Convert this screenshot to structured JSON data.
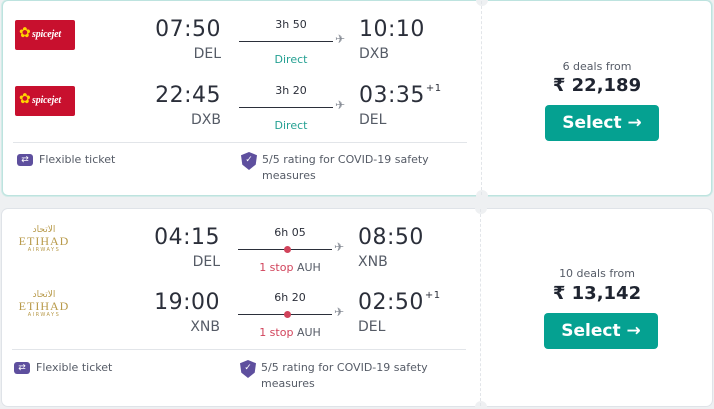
{
  "results": [
    {
      "legs": [
        {
          "airline_logo": "spicejet",
          "logo_text": "spicejet",
          "dep_time": "07:50",
          "dep_code": "DEL",
          "duration": "3h 50",
          "stops_label": "Direct",
          "stop_airport": "",
          "arr_time": "10:10",
          "arr_plus": "",
          "arr_code": "DXB"
        },
        {
          "airline_logo": "spicejet",
          "logo_text": "spicejet",
          "dep_time": "22:45",
          "dep_code": "DXB",
          "duration": "3h 20",
          "stops_label": "Direct",
          "stop_airport": "",
          "arr_time": "03:35",
          "arr_plus": "+1",
          "arr_code": "DEL"
        }
      ],
      "features": {
        "flexible": "Flexible ticket",
        "covid": "5/5 rating for COVID-19 safety measures"
      },
      "deals_label": "6 deals from",
      "price": "₹ 22,189",
      "select_label": "Select →"
    },
    {
      "legs": [
        {
          "airline_logo": "etihad",
          "logo_arabic": "الاتحاد",
          "logo_text": "ETIHAD",
          "logo_sub": "AIRWAYS",
          "dep_time": "04:15",
          "dep_code": "DEL",
          "duration": "6h 05",
          "stops_label": "1 stop",
          "stop_airport": "AUH",
          "arr_time": "08:50",
          "arr_plus": "",
          "arr_code": "XNB"
        },
        {
          "airline_logo": "etihad",
          "logo_arabic": "الاتحاد",
          "logo_text": "ETIHAD",
          "logo_sub": "AIRWAYS",
          "dep_time": "19:00",
          "dep_code": "XNB",
          "duration": "6h 20",
          "stops_label": "1 stop",
          "stop_airport": "AUH",
          "arr_time": "02:50",
          "arr_plus": "+1",
          "arr_code": "DEL"
        }
      ],
      "features": {
        "flexible": "Flexible ticket",
        "covid": "5/5 rating for COVID-19 safety measures"
      },
      "deals_label": "10 deals from",
      "price": "₹ 13,142",
      "select_label": "Select →"
    }
  ],
  "icons": {
    "plane": "plane-icon",
    "ticket": "flexible-ticket-icon",
    "shield": "shield-icon"
  },
  "colors": {
    "accent": "#05a191",
    "direct": "#24a092",
    "stop": "#d1435b",
    "feature_icon": "#5e4f9e",
    "spicejet": "#c8102e",
    "etihad": "#b89a4a"
  }
}
